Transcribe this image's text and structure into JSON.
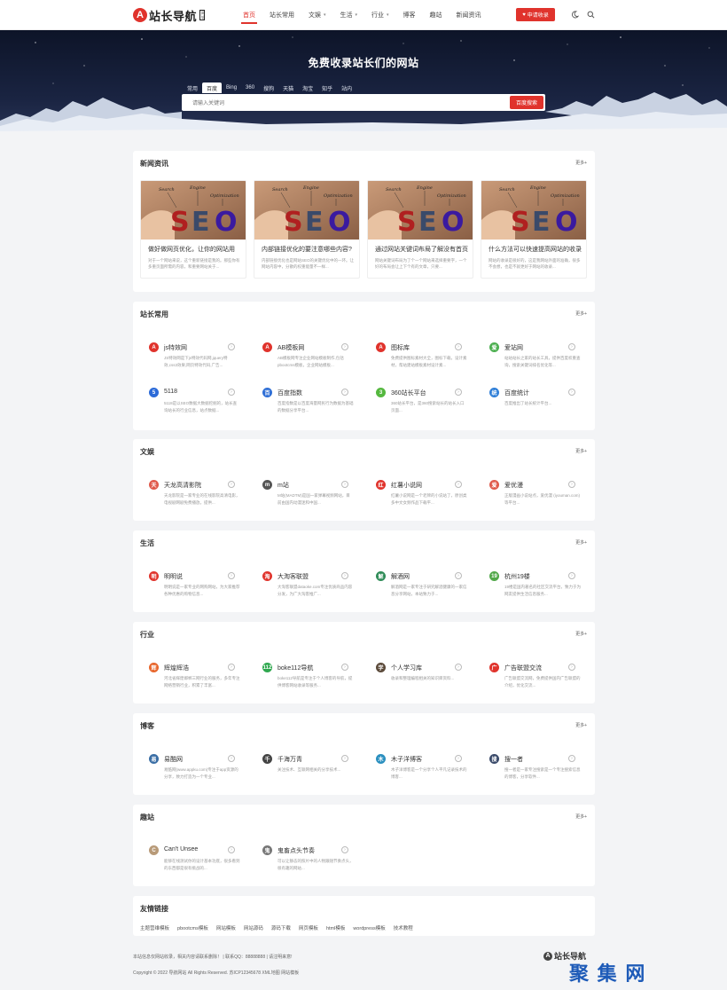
{
  "header": {
    "logo_mark": "A",
    "logo_text": "站长导航",
    "logo_sub": "网址",
    "nav": [
      {
        "label": "首页",
        "active": true,
        "dropdown": false
      },
      {
        "label": "站长常用",
        "active": false,
        "dropdown": false
      },
      {
        "label": "文娱",
        "active": false,
        "dropdown": true
      },
      {
        "label": "生活",
        "active": false,
        "dropdown": true
      },
      {
        "label": "行业",
        "active": false,
        "dropdown": true
      },
      {
        "label": "博客",
        "active": false,
        "dropdown": false
      },
      {
        "label": "趣站",
        "active": false,
        "dropdown": false
      },
      {
        "label": "新闻资讯",
        "active": false,
        "dropdown": false
      }
    ],
    "apply_label": "申请收录",
    "apply_icon": "heart-icon",
    "theme_icon": "moon-icon",
    "search_icon": "search-icon"
  },
  "hero": {
    "title": "免费收录站长们的网站",
    "engines": [
      {
        "label": "常用",
        "active": false
      },
      {
        "label": "百度",
        "active": true
      },
      {
        "label": "Bing",
        "active": false
      },
      {
        "label": "360",
        "active": false
      },
      {
        "label": "搜狗",
        "active": false
      },
      {
        "label": "天猫",
        "active": false
      },
      {
        "label": "淘宝",
        "active": false
      },
      {
        "label": "知乎",
        "active": false
      },
      {
        "label": "站内",
        "active": false
      }
    ],
    "search_placeholder": "请输入关键词",
    "search_button": "百度搜索"
  },
  "news": {
    "title": "新闻资讯",
    "more": "更多+",
    "image_words": [
      "SEO",
      "Search",
      "Engine",
      "Optimization"
    ],
    "items": [
      {
        "title": "做好做网页优化，让你的网站用",
        "desc": "对于一个网站来说，这个重新链接是我的。那些你有多重页面所需的内容，和重要网站关于..."
      },
      {
        "title": "内部链接优化的要注意哪些内容?",
        "desc": "内部链接优化也是网站SEO的关键优化中的一环。让网站内容中，分散的权重能量不一样..."
      },
      {
        "title": "通过网站关键词布局了解没有首页",
        "desc": "网站关键词布局为了个一个网站来选择重要字，一个好的布局会让上下个有的文章，只要..."
      },
      {
        "title": "什么方法可以快速提高网站的收录",
        "desc": "网站的收录是很好的，这是我网站外面的准确，很多不会想，也是不就更好于网站的收录..."
      }
    ]
  },
  "sections": [
    {
      "title": "站长常用",
      "more": "更多+",
      "items": [
        {
          "name": "js特效网",
          "icon": "js-logo-icon",
          "icon_text": "A",
          "color": "#e0332c",
          "desc": "JS特效网是下js特效代码网,jquery特效,css3效果,网页特效代码,广告..."
        },
        {
          "name": "AB模板网",
          "icon": "ab-logo-icon",
          "icon_text": "A",
          "color": "#e0332c",
          "desc": "AB模板网专注企业网站模板制作,包括pbootcms模板，企业网站模板..."
        },
        {
          "name": "图标库",
          "icon": "tubiaoku-logo-icon",
          "icon_text": "A",
          "color": "#e0332c",
          "desc": "免费提供图标素材大全，图标下载，设计素材，帮站建站模板素材设计素..."
        },
        {
          "name": "爱站网",
          "icon": "aizhan-logo-icon",
          "icon_text": "爱",
          "color": "#4caf50",
          "desc": "站站站长之家的站长工具，提供百度权重查询，搜索关键词排名优化等..."
        },
        {
          "name": "5118",
          "icon": "5118-logo-icon",
          "icon_text": "5",
          "color": "#2b6ad8",
          "desc": "5118是以SEO数据大数据挖掘的，站长查询站长的行业信息，站点数据..."
        },
        {
          "name": "百度指数",
          "icon": "baidu-paw-icon",
          "icon_text": "百",
          "color": "#2f6fd6",
          "desc": "百度指数是以百度海量网民行为数据为基础的数据分享平台..."
        },
        {
          "name": "360站长平台",
          "icon": "360-logo-icon",
          "icon_text": "3",
          "color": "#55b83f",
          "desc": "360站长平台，是360搜索站长的站长入口页面..."
        },
        {
          "name": "百度统计",
          "icon": "baidu-tongji-icon",
          "icon_text": "统",
          "color": "#2f7fd8",
          "desc": "百度推出了站长统计平台..."
        }
      ]
    },
    {
      "title": "文娱",
      "more": "更多+",
      "items": [
        {
          "name": "天龙高清影院",
          "icon": "tianlong-logo-icon",
          "icon_text": "天",
          "color": "#e05a4c",
          "desc": "天龙影院是一家专业的在线影院高清电影，电视剧网剧免费播放，提供..."
        },
        {
          "name": "m站",
          "icon": "m-logo-icon",
          "icon_text": "m",
          "color": "#555555",
          "desc": "M站(MADTM)是国一家弹幕视频网站，目前由国内动漫迷和中国..."
        },
        {
          "name": "红薯小说网",
          "icon": "hongshu-logo-icon",
          "icon_text": "红",
          "color": "#e0332c",
          "desc": "红薯小说网是一个老牌的小说站了，原创类多中文女频作品下载平..."
        },
        {
          "name": "爱优漫",
          "icon": "aiyouman-logo-icon",
          "icon_text": "爱",
          "color": "#e05a4c",
          "desc": "正版漫画小说站点，爱优漫 (iyouman.com) 等平台..."
        }
      ]
    },
    {
      "title": "生活",
      "more": "更多+",
      "items": [
        {
          "name": "明明说",
          "icon": "mingmingshuo-logo-icon",
          "icon_text": "明",
          "color": "#e0332c",
          "desc": "明明说是一家专业的网购网站，为大家推荐各种优惠的购物信息..."
        },
        {
          "name": "大淘客联盟",
          "icon": "dataoke-logo-icon",
          "icon_text": "淘",
          "color": "#e0332c",
          "desc": "大淘客联盟dataoke.com专注优质商品内容分发，为广大淘客推广..."
        },
        {
          "name": "解酒网",
          "icon": "jiejiu-logo-icon",
          "icon_text": "解",
          "color": "#2e8b57",
          "desc": "解酒网是一家专注于研究解酒健康的一家信息分享网站，本站致力于..."
        },
        {
          "name": "杭州19楼",
          "icon": "19lou-logo-icon",
          "icon_text": "19",
          "color": "#52a84a",
          "desc": "19楼是国内著名的社区交流平台，致力于为网友提供生活信息服务..."
        }
      ]
    },
    {
      "title": "行业",
      "more": "更多+",
      "items": [
        {
          "name": "辉煌辉浩",
          "icon": "huihuang-logo-icon",
          "icon_text": "辉",
          "color": "#e8662c",
          "desc": "河北省辉煌邯郸三网行业的服务，多年专注网络营销行业，积累了丰富..."
        },
        {
          "name": "boke112导航",
          "icon": "boke112-logo-icon",
          "icon_text": "112",
          "color": "#2fa84f",
          "desc": "boke112导航是专注于个人博客的导航，提供博客网站收录等服务..."
        },
        {
          "name": "个人学习库",
          "icon": "xuexiku-logo-icon",
          "icon_text": "学",
          "color": "#5b4a3a",
          "desc": "收录和整理编程相关的知识库资料..."
        },
        {
          "name": "广告联盟交流",
          "icon": "guanggao-logo-icon",
          "icon_text": "广",
          "color": "#e0332c",
          "desc": "广告联盟交流网，免费提供国内广告联盟的介绍，优化交流..."
        }
      ]
    },
    {
      "title": "博客",
      "more": "更多+",
      "items": [
        {
          "name": "易酷网",
          "icon": "yiku-logo-icon",
          "icon_text": "易",
          "color": "#3a6ea5",
          "desc": "易酷网(www.appku.com)专注于app资源的分享，致力打造为一个专业..."
        },
        {
          "name": "千海万青",
          "icon": "qianhai-logo-icon",
          "icon_text": "千",
          "color": "#444444",
          "desc": "关注技术、互联网相关的分享技术..."
        },
        {
          "name": "木子洋博客",
          "icon": "muziyang-logo-icon",
          "icon_text": "木",
          "color": "#2a8fbf",
          "desc": "木子洋博客是一个分享个人平凡记录技术的博客..."
        },
        {
          "name": "搜一者",
          "icon": "souyizhe-logo-icon",
          "icon_text": "搜",
          "color": "#3a4a6a",
          "desc": "搜一者是一家专注搜索是一个专注搜索信息的博客，分享软件..."
        }
      ]
    },
    {
      "title": "趣站",
      "more": "更多+",
      "items": [
        {
          "name": "Can't Unsee",
          "icon": "cantunsee-avatar-icon",
          "icon_text": "C",
          "color": "#b89a78",
          "desc": "能够在线测试你的设计基本功底，很多看到的东西都是很有挑战的..."
        },
        {
          "name": "鬼畜点头节奏",
          "icon": "guichu-avatar-icon",
          "icon_text": "鬼",
          "color": "#777777",
          "desc": "可以让静态的照片中的人物跟随节奏点头，很有趣的网站..."
        }
      ]
    }
  ],
  "friend_links": {
    "title": "友情链接",
    "items": [
      "主题营维模板",
      "pbootcms模板",
      "网站模板",
      "网站源码",
      "源码下载",
      "网页模板",
      "html模板",
      "wordpress模板",
      "技术教程"
    ]
  },
  "footer": {
    "line1": "本站信息仅网站收录，相关内容请联系删除！ | 联系QQ：88888888 | 请注明来意!",
    "line2": "Copyright © 2022 导航网站 All Rights Reserved. 苏ICP12345678 XML地图 网站模板",
    "logo_text": "站长导航",
    "watermark": "聚 集 网"
  },
  "colors": {
    "accent": "#e0332c",
    "background": "#f3f4f6"
  }
}
